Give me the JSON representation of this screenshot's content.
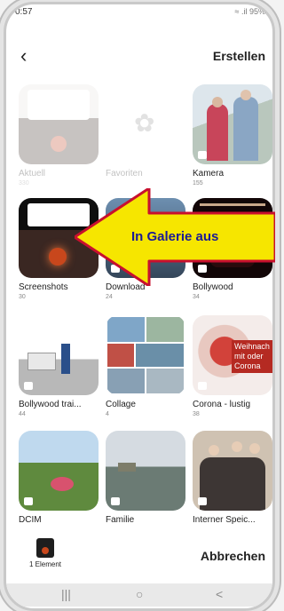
{
  "status": {
    "time": "0:57",
    "right": "≈ .il 95%"
  },
  "header": {
    "back_icon": "chevron-left-icon",
    "create_label": "Erstellen"
  },
  "albums": [
    {
      "label": "Aktuell",
      "count": "330"
    },
    {
      "label": "Favoriten",
      "count": ""
    },
    {
      "label": "Kamera",
      "count": "155"
    },
    {
      "label": "Screenshots",
      "count": "30"
    },
    {
      "label": "Download",
      "count": "24"
    },
    {
      "label": "Bollywood",
      "count": "34"
    },
    {
      "label": "Bollywood  trai...",
      "count": "44"
    },
    {
      "label": "Collage",
      "count": "4"
    },
    {
      "label": "Corona - lustig",
      "count": "38"
    },
    {
      "label": "DCIM",
      "count": ""
    },
    {
      "label": "Familie",
      "count": ""
    },
    {
      "label": "Interner Speic...",
      "count": ""
    }
  ],
  "corona_overlay": "Weihnach\nmit oder\nCorona",
  "annotation": {
    "text": "In Galerie aus",
    "fill": "#f6e600",
    "border": "#c8102e"
  },
  "bottom": {
    "selection_label": "1 Element",
    "cancel_label": "Abbrechen"
  },
  "navbar": {
    "recent": "|||",
    "home": "○",
    "back": "<"
  }
}
